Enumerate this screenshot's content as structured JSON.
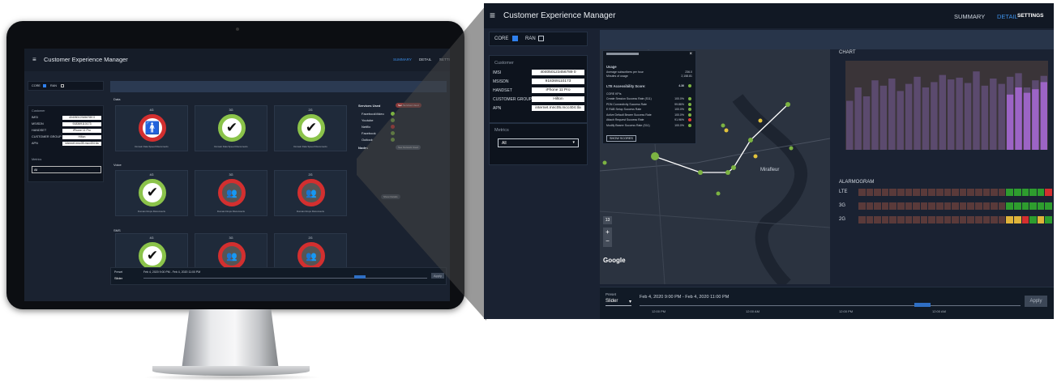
{
  "app": {
    "title": "Customer Experience Manager",
    "menu_icon": "hamburger-icon"
  },
  "tabs": {
    "summary": "SUMMARY",
    "detail": "DETAIL",
    "settings": "SETTINGS"
  },
  "filters": {
    "core": "CORE",
    "ran": "RAN"
  },
  "customer": {
    "heading": "Customer",
    "imsi_label": "IMSI",
    "imsi": "404050123456789 0",
    "msisdn_label": "MSISDN",
    "msisdn": "918369110173",
    "handset_label": "HANDSET",
    "handset": "iPhone 11 Pro",
    "group_label": "CUSTOMER GROUP",
    "group": "Hilton",
    "apn_label": "APN",
    "apn": "internet.mnc05.mcc404.tla"
  },
  "metrics": {
    "heading": "Metrics",
    "selected": "All"
  },
  "small": {
    "data_label": "Data",
    "voice_label": "Voice",
    "sms_label": "SMS",
    "tiles": [
      "4G",
      "3G",
      "2G"
    ],
    "services_title": "Services Used",
    "services_btn": "See Services Used",
    "services": [
      "FacebookVideo",
      "Youtube",
      "Netflix",
      "Facebook",
      "Outlook"
    ],
    "nodes_title": "Nodes",
    "nodes_btn": "See Network Used",
    "show_details": "Show Details",
    "apply": "Apply",
    "legend_data": "Domain  Data Speed  Disconnects",
    "legend_voice": "Domain  Drops  Disconnects"
  },
  "map": {
    "popup": {
      "usage_title": "Usage",
      "subs_label": "Average subscribers per hour",
      "subs": "236.0",
      "minutes_label": "Minutes of usage",
      "minutes": "2,158.81",
      "lte_label": "LTE Accessibility Score:",
      "lte_score": "4.36",
      "kpi_heading": "CORE KPIs",
      "kpis": [
        {
          "name": "Create Session Success Rate (S11)",
          "value": "100.0%",
          "ok": true
        },
        {
          "name": "PDN Connectivity Success Rate",
          "value": "99.86%",
          "ok": true
        },
        {
          "name": "E RAB Setup Success Rate",
          "value": "100.0%",
          "ok": true
        },
        {
          "name": "Active Default Bearer Success Rate",
          "value": "100.0%",
          "ok": true
        },
        {
          "name": "Attach Request Success Rate",
          "value": "91.96%",
          "ok": false
        },
        {
          "name": "Modify Bearer Success Rate (S11)",
          "value": "100.0%",
          "ok": true
        }
      ],
      "show_scores": "SHOW SCORES"
    },
    "city": "Mirafleur",
    "google": "Google",
    "zoom_badge": "13"
  },
  "chart_data": {
    "type": "bar",
    "title": "CHART",
    "series": [
      {
        "name": "",
        "color": "#5b4a6e",
        "values": [
          55,
          70,
          60,
          78,
          72,
          80,
          66,
          74,
          82,
          70,
          76,
          84,
          79,
          81,
          75,
          88,
          72,
          80,
          74,
          82,
          86,
          70,
          78,
          83
        ]
      },
      {
        "name": "",
        "color": "#9c64c5",
        "values": [
          0,
          0,
          0,
          0,
          0,
          0,
          0,
          0,
          0,
          0,
          0,
          0,
          0,
          0,
          0,
          0,
          0,
          0,
          0,
          62,
          70,
          64,
          68,
          76
        ]
      }
    ]
  },
  "alarmogram": {
    "title": "ALARMOGRAM",
    "rows": [
      {
        "label": "LTE",
        "cells": "dddddddddddddddddddgggggr"
      },
      {
        "label": "3G",
        "cells": "dddddddddddddddddddgggggg"
      },
      {
        "label": "2G",
        "cells": "dddddddddddddddddddyyrgyg"
      }
    ]
  },
  "timeline": {
    "preset_label": "Preset",
    "preset": "Slider",
    "range": "Feb 4, 2020 9:00 PM - Feb 4, 2020 11:00 PM",
    "ticks": [
      "12:00 PM",
      "12:00 AM",
      "12:00 PM",
      "12:00 AM"
    ],
    "apply": "Apply"
  }
}
